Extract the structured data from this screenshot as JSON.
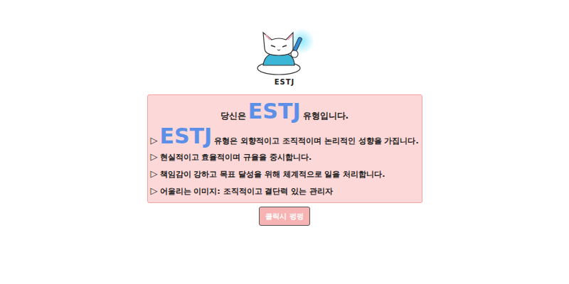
{
  "mascot": {
    "label": "ESTJ"
  },
  "result": {
    "prefix": "당신은",
    "type": "ESTJ",
    "suffix": "유형입니다."
  },
  "lines": [
    {
      "kind": "highlight",
      "bullet": "▷",
      "highlight": "ESTJ",
      "text": "유형은 외향적이고 조직적이며 논리적인 성향을 가집니다."
    },
    {
      "kind": "plain",
      "bullet": "▷",
      "text": "현실적이고 효율적이며 규율을 중시합니다."
    },
    {
      "kind": "plain",
      "bullet": "▷",
      "text": "책임감이 강하고 목표 달성을 위해 체계적으로 일을 처리합니다."
    },
    {
      "kind": "plain",
      "bullet": "▷",
      "text": "어울리는 이미지: 조직적이고 결단력 있는 관리자"
    }
  ],
  "button": {
    "label": "클릭시 펑펑"
  }
}
